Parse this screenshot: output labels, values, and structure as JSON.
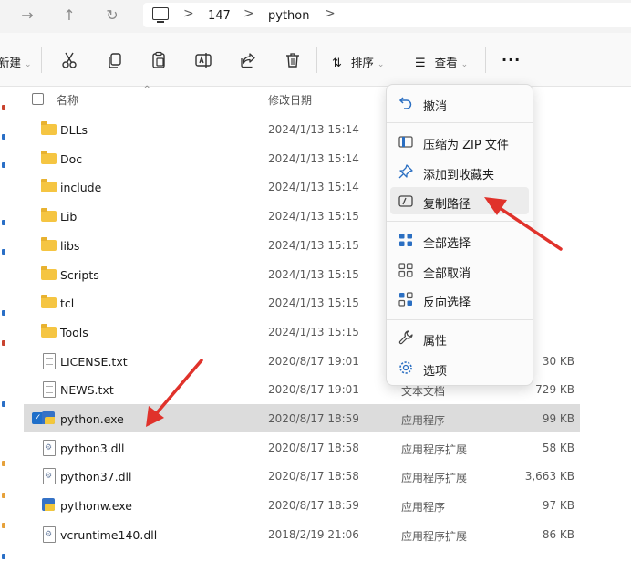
{
  "addressbar": {
    "breadcrumbs": [
      "147",
      "python"
    ]
  },
  "toolbar": {
    "new_label": "新建",
    "sort_label": "排序",
    "view_label": "查看",
    "more_label": "..."
  },
  "list": {
    "columns": {
      "name": "名称",
      "date": "修改日期"
    },
    "rows": [
      {
        "kind": "folder",
        "name": "DLLs",
        "date": "2024/1/13 15:14",
        "type": "",
        "size": ""
      },
      {
        "kind": "folder",
        "name": "Doc",
        "date": "2024/1/13 15:14",
        "type": "",
        "size": ""
      },
      {
        "kind": "folder",
        "name": "include",
        "date": "2024/1/13 15:14",
        "type": "",
        "size": ""
      },
      {
        "kind": "folder",
        "name": "Lib",
        "date": "2024/1/13 15:15",
        "type": "",
        "size": ""
      },
      {
        "kind": "folder",
        "name": "libs",
        "date": "2024/1/13 15:15",
        "type": "",
        "size": ""
      },
      {
        "kind": "folder",
        "name": "Scripts",
        "date": "2024/1/13 15:15",
        "type": "",
        "size": ""
      },
      {
        "kind": "folder",
        "name": "tcl",
        "date": "2024/1/13 15:15",
        "type": "",
        "size": ""
      },
      {
        "kind": "folder",
        "name": "Tools",
        "date": "2024/1/13 15:15",
        "type": "",
        "size": ""
      },
      {
        "kind": "doc",
        "name": "LICENSE.txt",
        "date": "2020/8/17 19:01",
        "type": "",
        "size": "30 KB"
      },
      {
        "kind": "doc",
        "name": "NEWS.txt",
        "date": "2020/8/17 19:01",
        "type": "文本文档",
        "size": "729 KB"
      },
      {
        "kind": "exe",
        "name": "python.exe",
        "date": "2020/8/17 18:59",
        "type": "应用程序",
        "size": "99 KB",
        "selected": true
      },
      {
        "kind": "dll",
        "name": "python3.dll",
        "date": "2020/8/17 18:58",
        "type": "应用程序扩展",
        "size": "58 KB"
      },
      {
        "kind": "dll",
        "name": "python37.dll",
        "date": "2020/8/17 18:58",
        "type": "应用程序扩展",
        "size": "3,663 KB"
      },
      {
        "kind": "exe",
        "name": "pythonw.exe",
        "date": "2020/8/17 18:59",
        "type": "应用程序",
        "size": "97 KB"
      },
      {
        "kind": "dll",
        "name": "vcruntime140.dll",
        "date": "2018/2/19 21:06",
        "type": "应用程序扩展",
        "size": "86 KB"
      }
    ]
  },
  "contextmenu": {
    "items": [
      {
        "label": "撤消",
        "icon": "undo-icon"
      },
      {
        "label": "压缩为 ZIP 文件",
        "icon": "zip-icon"
      },
      {
        "label": "添加到收藏夹",
        "icon": "pin-icon"
      },
      {
        "label": "复制路径",
        "icon": "copy-path-icon"
      },
      {
        "label": "全部选择",
        "icon": "select-all-icon"
      },
      {
        "label": "全部取消",
        "icon": "select-none-icon"
      },
      {
        "label": "反向选择",
        "icon": "invert-selection-icon"
      },
      {
        "label": "属性",
        "icon": "wrench-icon"
      },
      {
        "label": "选项",
        "icon": "gear-icon"
      }
    ]
  },
  "colors": {
    "accent": "#1f6fc9",
    "annotation": "#e0322b",
    "folder": "#f5c542"
  }
}
